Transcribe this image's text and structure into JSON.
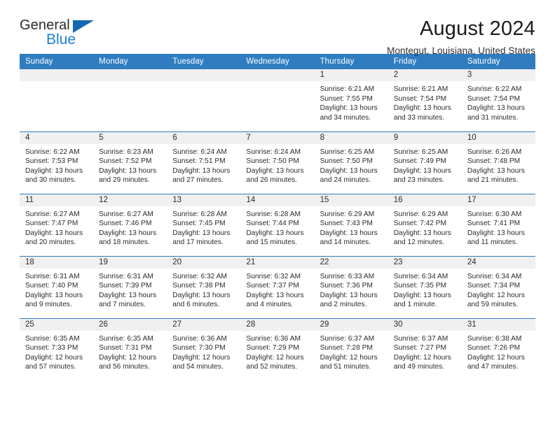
{
  "brand": {
    "name_part1": "General",
    "name_part2": "Blue",
    "triangle_icon": "blue-triangle-icon",
    "colors": {
      "dark": "#2b2b2b",
      "blue": "#1b7fd4",
      "triangle": "#1268b3"
    }
  },
  "header": {
    "title": "August 2024",
    "subtitle": "Montegut, Louisiana, United States"
  },
  "calendar": {
    "header_bg": "#2f7dc0",
    "daynum_bg": "#f0f0f0",
    "weekdays": [
      "Sunday",
      "Monday",
      "Tuesday",
      "Wednesday",
      "Thursday",
      "Friday",
      "Saturday"
    ],
    "labels": {
      "sunrise": "Sunrise:",
      "sunset": "Sunset:",
      "daylight": "Daylight:"
    },
    "weeks": [
      [
        {
          "day": ""
        },
        {
          "day": ""
        },
        {
          "day": ""
        },
        {
          "day": ""
        },
        {
          "day": "1",
          "sunrise": "Sunrise: 6:21 AM",
          "sunset": "Sunset: 7:55 PM",
          "daylight_line1": "Daylight: 13 hours",
          "daylight_line2": "and 34 minutes."
        },
        {
          "day": "2",
          "sunrise": "Sunrise: 6:21 AM",
          "sunset": "Sunset: 7:54 PM",
          "daylight_line1": "Daylight: 13 hours",
          "daylight_line2": "and 33 minutes."
        },
        {
          "day": "3",
          "sunrise": "Sunrise: 6:22 AM",
          "sunset": "Sunset: 7:54 PM",
          "daylight_line1": "Daylight: 13 hours",
          "daylight_line2": "and 31 minutes."
        }
      ],
      [
        {
          "day": "4",
          "sunrise": "Sunrise: 6:22 AM",
          "sunset": "Sunset: 7:53 PM",
          "daylight_line1": "Daylight: 13 hours",
          "daylight_line2": "and 30 minutes."
        },
        {
          "day": "5",
          "sunrise": "Sunrise: 6:23 AM",
          "sunset": "Sunset: 7:52 PM",
          "daylight_line1": "Daylight: 13 hours",
          "daylight_line2": "and 29 minutes."
        },
        {
          "day": "6",
          "sunrise": "Sunrise: 6:24 AM",
          "sunset": "Sunset: 7:51 PM",
          "daylight_line1": "Daylight: 13 hours",
          "daylight_line2": "and 27 minutes."
        },
        {
          "day": "7",
          "sunrise": "Sunrise: 6:24 AM",
          "sunset": "Sunset: 7:50 PM",
          "daylight_line1": "Daylight: 13 hours",
          "daylight_line2": "and 26 minutes."
        },
        {
          "day": "8",
          "sunrise": "Sunrise: 6:25 AM",
          "sunset": "Sunset: 7:50 PM",
          "daylight_line1": "Daylight: 13 hours",
          "daylight_line2": "and 24 minutes."
        },
        {
          "day": "9",
          "sunrise": "Sunrise: 6:25 AM",
          "sunset": "Sunset: 7:49 PM",
          "daylight_line1": "Daylight: 13 hours",
          "daylight_line2": "and 23 minutes."
        },
        {
          "day": "10",
          "sunrise": "Sunrise: 6:26 AM",
          "sunset": "Sunset: 7:48 PM",
          "daylight_line1": "Daylight: 13 hours",
          "daylight_line2": "and 21 minutes."
        }
      ],
      [
        {
          "day": "11",
          "sunrise": "Sunrise: 6:27 AM",
          "sunset": "Sunset: 7:47 PM",
          "daylight_line1": "Daylight: 13 hours",
          "daylight_line2": "and 20 minutes."
        },
        {
          "day": "12",
          "sunrise": "Sunrise: 6:27 AM",
          "sunset": "Sunset: 7:46 PM",
          "daylight_line1": "Daylight: 13 hours",
          "daylight_line2": "and 18 minutes."
        },
        {
          "day": "13",
          "sunrise": "Sunrise: 6:28 AM",
          "sunset": "Sunset: 7:45 PM",
          "daylight_line1": "Daylight: 13 hours",
          "daylight_line2": "and 17 minutes."
        },
        {
          "day": "14",
          "sunrise": "Sunrise: 6:28 AM",
          "sunset": "Sunset: 7:44 PM",
          "daylight_line1": "Daylight: 13 hours",
          "daylight_line2": "and 15 minutes."
        },
        {
          "day": "15",
          "sunrise": "Sunrise: 6:29 AM",
          "sunset": "Sunset: 7:43 PM",
          "daylight_line1": "Daylight: 13 hours",
          "daylight_line2": "and 14 minutes."
        },
        {
          "day": "16",
          "sunrise": "Sunrise: 6:29 AM",
          "sunset": "Sunset: 7:42 PM",
          "daylight_line1": "Daylight: 13 hours",
          "daylight_line2": "and 12 minutes."
        },
        {
          "day": "17",
          "sunrise": "Sunrise: 6:30 AM",
          "sunset": "Sunset: 7:41 PM",
          "daylight_line1": "Daylight: 13 hours",
          "daylight_line2": "and 11 minutes."
        }
      ],
      [
        {
          "day": "18",
          "sunrise": "Sunrise: 6:31 AM",
          "sunset": "Sunset: 7:40 PM",
          "daylight_line1": "Daylight: 13 hours",
          "daylight_line2": "and 9 minutes."
        },
        {
          "day": "19",
          "sunrise": "Sunrise: 6:31 AM",
          "sunset": "Sunset: 7:39 PM",
          "daylight_line1": "Daylight: 13 hours",
          "daylight_line2": "and 7 minutes."
        },
        {
          "day": "20",
          "sunrise": "Sunrise: 6:32 AM",
          "sunset": "Sunset: 7:38 PM",
          "daylight_line1": "Daylight: 13 hours",
          "daylight_line2": "and 6 minutes."
        },
        {
          "day": "21",
          "sunrise": "Sunrise: 6:32 AM",
          "sunset": "Sunset: 7:37 PM",
          "daylight_line1": "Daylight: 13 hours",
          "daylight_line2": "and 4 minutes."
        },
        {
          "day": "22",
          "sunrise": "Sunrise: 6:33 AM",
          "sunset": "Sunset: 7:36 PM",
          "daylight_line1": "Daylight: 13 hours",
          "daylight_line2": "and 2 minutes."
        },
        {
          "day": "23",
          "sunrise": "Sunrise: 6:34 AM",
          "sunset": "Sunset: 7:35 PM",
          "daylight_line1": "Daylight: 13 hours",
          "daylight_line2": "and 1 minute."
        },
        {
          "day": "24",
          "sunrise": "Sunrise: 6:34 AM",
          "sunset": "Sunset: 7:34 PM",
          "daylight_line1": "Daylight: 12 hours",
          "daylight_line2": "and 59 minutes."
        }
      ],
      [
        {
          "day": "25",
          "sunrise": "Sunrise: 6:35 AM",
          "sunset": "Sunset: 7:33 PM",
          "daylight_line1": "Daylight: 12 hours",
          "daylight_line2": "and 57 minutes."
        },
        {
          "day": "26",
          "sunrise": "Sunrise: 6:35 AM",
          "sunset": "Sunset: 7:31 PM",
          "daylight_line1": "Daylight: 12 hours",
          "daylight_line2": "and 56 minutes."
        },
        {
          "day": "27",
          "sunrise": "Sunrise: 6:36 AM",
          "sunset": "Sunset: 7:30 PM",
          "daylight_line1": "Daylight: 12 hours",
          "daylight_line2": "and 54 minutes."
        },
        {
          "day": "28",
          "sunrise": "Sunrise: 6:36 AM",
          "sunset": "Sunset: 7:29 PM",
          "daylight_line1": "Daylight: 12 hours",
          "daylight_line2": "and 52 minutes."
        },
        {
          "day": "29",
          "sunrise": "Sunrise: 6:37 AM",
          "sunset": "Sunset: 7:28 PM",
          "daylight_line1": "Daylight: 12 hours",
          "daylight_line2": "and 51 minutes."
        },
        {
          "day": "30",
          "sunrise": "Sunrise: 6:37 AM",
          "sunset": "Sunset: 7:27 PM",
          "daylight_line1": "Daylight: 12 hours",
          "daylight_line2": "and 49 minutes."
        },
        {
          "day": "31",
          "sunrise": "Sunrise: 6:38 AM",
          "sunset": "Sunset: 7:26 PM",
          "daylight_line1": "Daylight: 12 hours",
          "daylight_line2": "and 47 minutes."
        }
      ]
    ]
  }
}
